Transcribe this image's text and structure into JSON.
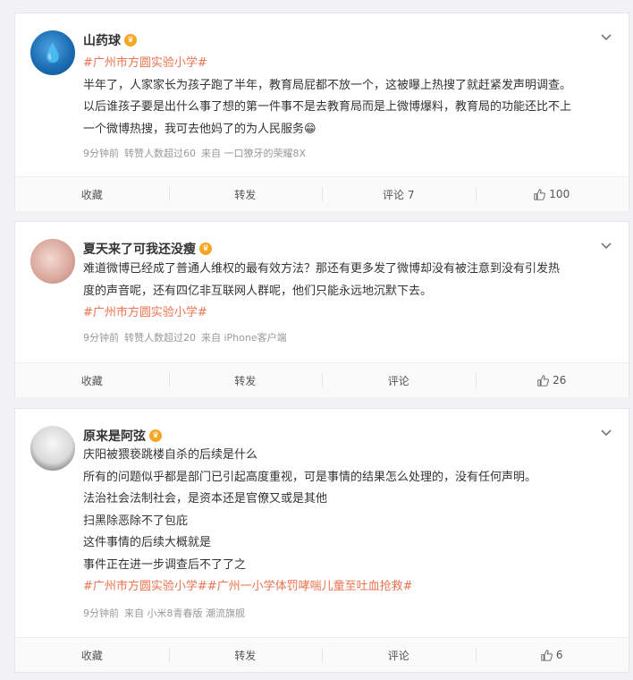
{
  "posts": [
    {
      "user": "山药球",
      "avatar_icon": "water-drop-avatar",
      "content": [
        "#广州市方圆实验小学#",
        "半年了，人家家长为孩子跑了半年，教育局屁都不放一个，这被曝上热搜了就赶紧发声明调查。",
        "以后谁孩子要是出什么事了想的第一件事不是去教育局而是上微博爆料，教育局的功能还比不上",
        "一个微博热搜，我可去他妈了的为人民服务😁"
      ],
      "topic_line_index": 0,
      "meta": {
        "time": "9分钟前",
        "forward_info": "转赞人数超过60",
        "source": "来自 一口獠牙的荣耀8X"
      },
      "actions": {
        "collect": "收藏",
        "forward": "转发",
        "comment": "评论 7",
        "like": "100"
      }
    },
    {
      "user": "夏天来了可我还没瘦",
      "avatar_icon": "photo-avatar",
      "content": [
        "难道微博已经成了普通人维权的最有效方法？那还有更多发了微博却没有被注意到没有引发热",
        "度的声音呢，还有四亿非互联网人群呢，他们只能永远地沉默下去。",
        "#广州市方圆实验小学#"
      ],
      "topic_line_index": 2,
      "meta": {
        "time": "9分钟前",
        "forward_info": "转赞人数超过20",
        "source": "来自 iPhone客户端"
      },
      "actions": {
        "collect": "收藏",
        "forward": "转发",
        "comment": "评论",
        "like": "26"
      }
    },
    {
      "user": "原来是阿弦",
      "avatar_icon": "portrait-avatar",
      "content": [
        "庆阳被猥亵跳楼自杀的后续是什么",
        "所有的问题似乎都是部门已引起高度重视，可是事情的结果怎么处理的，没有任何声明。",
        "法治社会法制社会，是资本还是官僚又或是其他",
        "扫黑除恶除不了包庇",
        "这件事情的后续大概就是",
        "事件正在进一步调查后不了了之",
        "#广州市方圆实验小学##广州一小学体罚哮喘儿童至吐血抢救#"
      ],
      "topic_line_index": 6,
      "meta": {
        "time": "9分钟前",
        "forward_info": "",
        "source": "来自 小米8青春版 潮流旗舰"
      },
      "actions": {
        "collect": "收藏",
        "forward": "转发",
        "comment": "评论",
        "like": "6"
      }
    }
  ],
  "colors": {
    "topic": "#eb7350",
    "background": "#f2f2f5",
    "vip_badge": "#f5a623"
  }
}
